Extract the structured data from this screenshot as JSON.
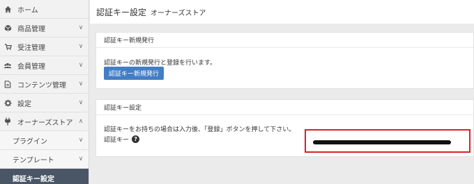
{
  "sidebar": {
    "items": [
      {
        "label": "ホーム",
        "icon": "home-icon",
        "chevron": ""
      },
      {
        "label": "商品管理",
        "icon": "cube-icon",
        "chevron": "∨"
      },
      {
        "label": "受注管理",
        "icon": "cart-icon",
        "chevron": "∨"
      },
      {
        "label": "会員管理",
        "icon": "users-icon",
        "chevron": "∨"
      },
      {
        "label": "コンテンツ管理",
        "icon": "file-icon",
        "chevron": "∨"
      },
      {
        "label": "設定",
        "icon": "gear-icon",
        "chevron": "∨"
      },
      {
        "label": "オーナーズストア",
        "icon": "plug-icon",
        "chevron": "∧"
      }
    ],
    "subitems": [
      {
        "label": "プラグイン",
        "chevron": "∨"
      },
      {
        "label": "テンプレート",
        "chevron": "∨"
      },
      {
        "label": "認証キー設定",
        "chevron": ""
      }
    ]
  },
  "page": {
    "title": "認証キー設定",
    "subtitle": "オーナーズストア"
  },
  "card_new": {
    "header": "認証キー新規発行",
    "description": "認証キーの新規発行と登録を行います。",
    "button": "認証キー新規発行"
  },
  "card_setting": {
    "header": "認証キー設定",
    "description": "認証キーをお持ちの場合は入力後、「登録」ボタンを押して下さい。",
    "key_label": "認証キー",
    "help_icon": "?"
  },
  "colors": {
    "accent": "#437ec4",
    "highlight": "#d9202a",
    "sidebar_active": "#4a5566"
  }
}
